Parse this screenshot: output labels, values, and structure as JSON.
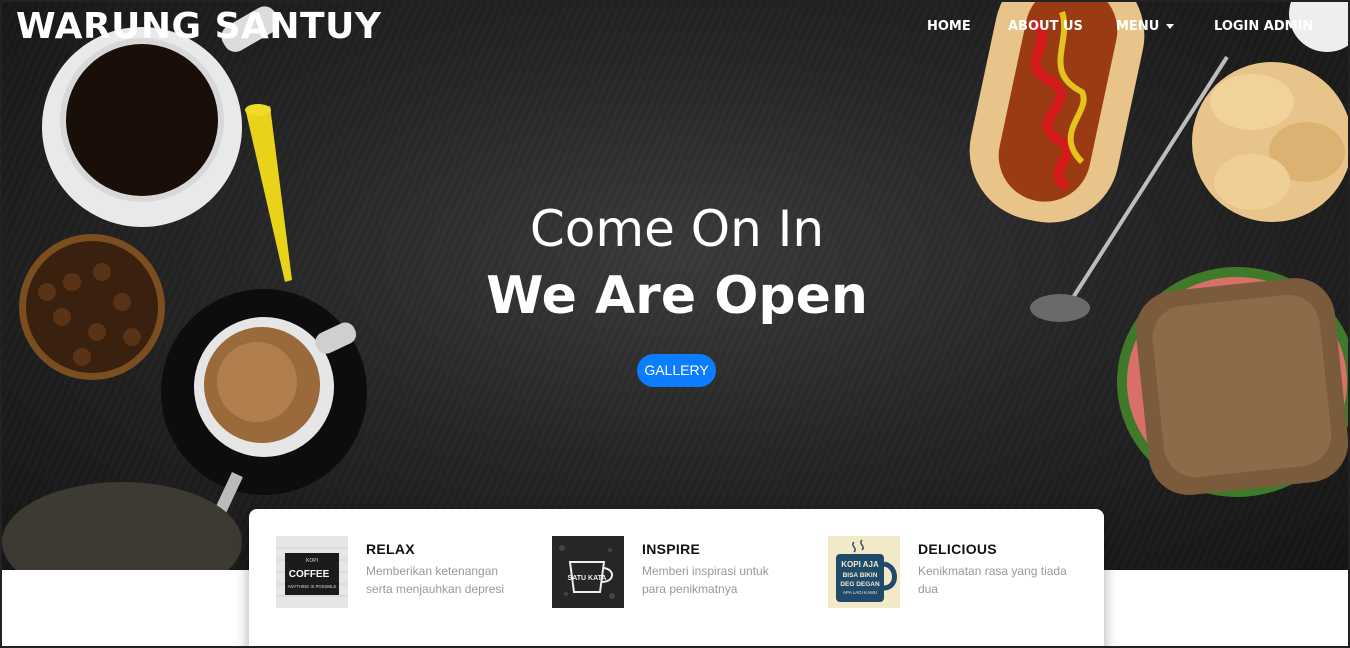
{
  "brand": "WARUNG SANTUY",
  "nav": {
    "home": "HOME",
    "about": "ABOUT US",
    "menu": "MENU",
    "login": "LOGIN ADMIN"
  },
  "hero": {
    "line1": "Come On In",
    "line2": "We Are Open",
    "button": "GALLERY"
  },
  "features": [
    {
      "title": "RELAX",
      "text": "Memberikan ketenangan serta menjauhkan depresi",
      "thumb_text": [
        "KOPI",
        "COFFEE",
        "ANYTHING IS POSSIBLE"
      ]
    },
    {
      "title": "INSPIRE",
      "text": "Memberi inspirasi untuk para penikmatnya",
      "thumb_text": [
        "SATU KATA"
      ]
    },
    {
      "title": "DELICIOUS",
      "text": "Kenikmatan rasa yang tiada dua",
      "thumb_text": [
        "KOPI AJA",
        "BISA BIKIN",
        "DEG DEGAN",
        "APA LAGI KAMU"
      ]
    }
  ],
  "colors": {
    "accent": "#0d7dff",
    "hero_bg": "#262626",
    "card_bg": "#ffffff"
  },
  "icons": {
    "menu_caret": "caret-down-icon"
  }
}
